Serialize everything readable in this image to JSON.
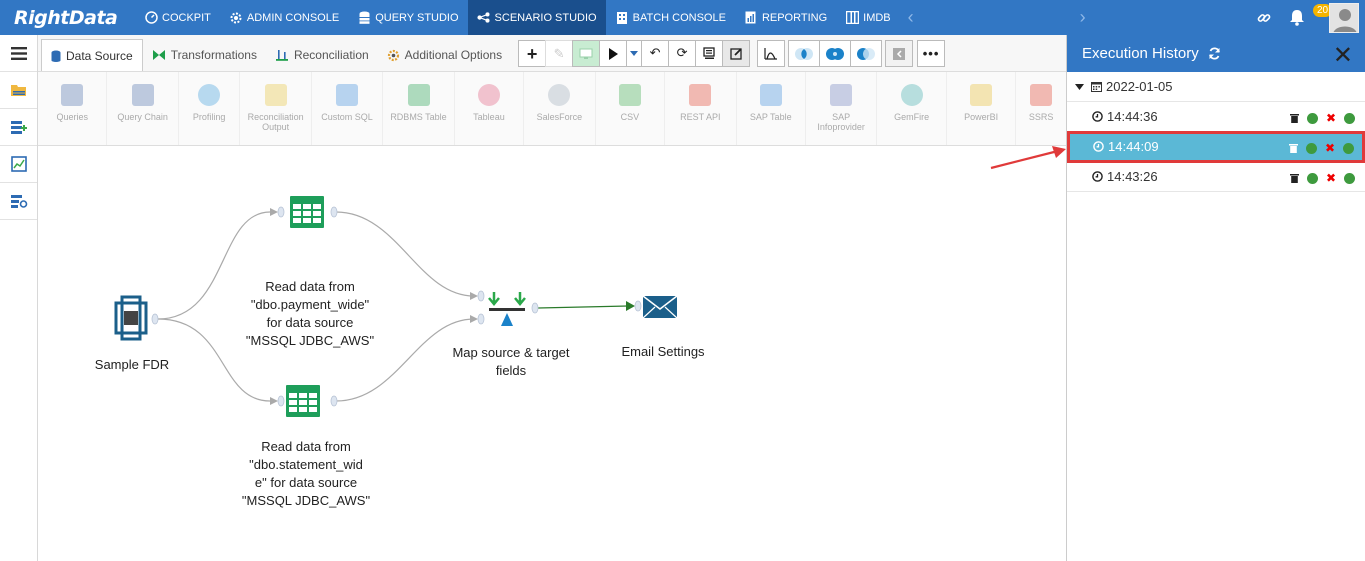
{
  "app": {
    "logo": "RightData"
  },
  "nav": {
    "items": [
      {
        "label": "COCKPIT",
        "icon": "gauge-icon"
      },
      {
        "label": "ADMIN CONSOLE",
        "icon": "gear-icon"
      },
      {
        "label": "QUERY STUDIO",
        "icon": "database-icon"
      },
      {
        "label": "SCENARIO STUDIO",
        "icon": "flow-icon",
        "active": true
      },
      {
        "label": "BATCH CONSOLE",
        "icon": "building-icon"
      },
      {
        "label": "REPORTING",
        "icon": "report-icon"
      },
      {
        "label": "IMDB",
        "icon": "columns-icon"
      }
    ],
    "notifications_count": "20"
  },
  "tabs": [
    {
      "label": "Data Source",
      "active": true
    },
    {
      "label": "Transformations"
    },
    {
      "label": "Reconciliation"
    },
    {
      "label": "Additional Options"
    }
  ],
  "ribbon": {
    "items": [
      "Queries",
      "Query Chain",
      "Profiling",
      "Reconciliation Output",
      "Custom SQL",
      "RDBMS Table",
      "Tableau",
      "SalesForce",
      "CSV",
      "REST API",
      "SAP Table",
      "SAP Infoprovider",
      "GemFire",
      "PowerBI",
      "SSRS"
    ]
  },
  "canvas": {
    "nodes": {
      "source": "Sample FDR",
      "read1": [
        "Read data from",
        "\"dbo.payment_wide\"",
        "for data source",
        "\"MSSQL JDBC_AWS\""
      ],
      "read2": [
        "Read data from",
        "\"dbo.statement_wid",
        "e\" for data source",
        "\"MSSQL JDBC_AWS\""
      ],
      "map": [
        "Map source & target",
        "fields"
      ],
      "email": "Email Settings"
    }
  },
  "history": {
    "title": "Execution History",
    "date": "2022-01-05",
    "runs": [
      {
        "time": "14:44:36",
        "selected": false
      },
      {
        "time": "14:44:09",
        "selected": true
      },
      {
        "time": "14:43:26",
        "selected": false
      }
    ]
  },
  "colors": {
    "brand": "#3277c4",
    "selected_row": "#5bb8d6",
    "highlight": "#e03a3a",
    "status_ok": "#3e9a3e"
  }
}
